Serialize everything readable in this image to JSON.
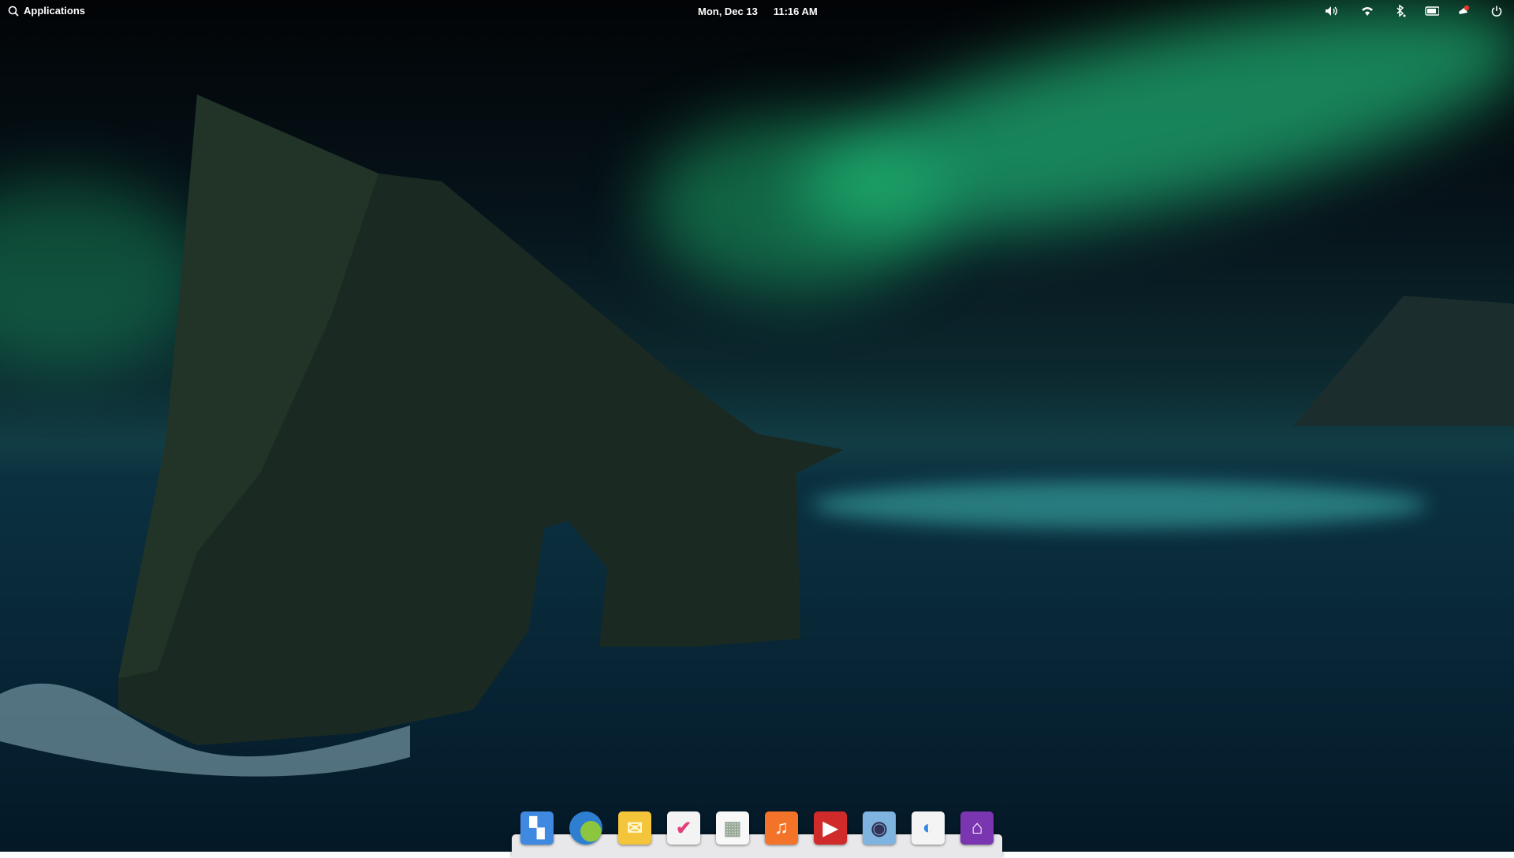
{
  "panel": {
    "applications_label": "Applications",
    "date": "Mon, Dec 13",
    "time": "11:16 AM",
    "indicators": [
      "volume-icon",
      "wifi-icon",
      "bluetooth-icon",
      "battery-icon",
      "notifications-icon",
      "power-icon"
    ]
  },
  "dock": {
    "items": [
      {
        "name": "multitasking-view",
        "color": "#3f8ae0"
      },
      {
        "name": "web-browser",
        "color": "#3a9ad8"
      },
      {
        "name": "mail",
        "color": "#f4c43a"
      },
      {
        "name": "tasks",
        "color": "#f3f3f3"
      },
      {
        "name": "calendar",
        "color": "#f8f8f8"
      },
      {
        "name": "music",
        "color": "#f37329"
      },
      {
        "name": "videos",
        "color": "#d02a2a"
      },
      {
        "name": "photos",
        "color": "#7fb4e0"
      },
      {
        "name": "system-settings",
        "color": "#f4f4f4"
      },
      {
        "name": "app-center",
        "color": "#7a36b1"
      }
    ]
  }
}
